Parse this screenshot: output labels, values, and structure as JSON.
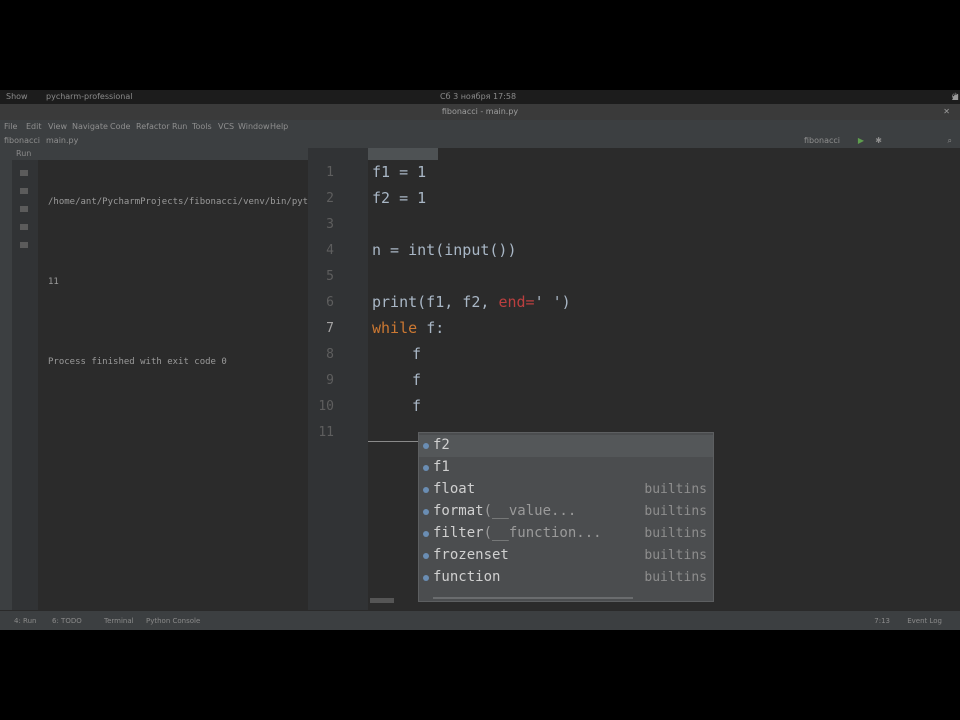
{
  "system": {
    "activities": "Show",
    "app_menu": "pycharm-professional",
    "clock": "Сб 3 ноября 17:58",
    "tray_icons": [
      "network-icon",
      "volume-icon",
      "power-icon"
    ]
  },
  "window": {
    "title": "fibonacci - main.py"
  },
  "menu": {
    "items": [
      "File",
      "Edit",
      "View",
      "Navigate",
      "Code",
      "Refactor",
      "Run",
      "Tools",
      "VCS",
      "Window",
      "Help"
    ]
  },
  "nav": {
    "project": "fibonacci",
    "file": "main.py",
    "run_config": "fibonacci"
  },
  "run_panel": {
    "tab": "Run",
    "lines": [
      "/home/ant/PycharmProjects/fibonacci/venv/bin/python",
      "",
      "11",
      "",
      "Process finished with exit code 0"
    ]
  },
  "editor": {
    "tab": "main.py",
    "line_numbers": [
      "1",
      "2",
      "3",
      "4",
      "5",
      "6",
      "7",
      "8",
      "9",
      "10",
      "11"
    ],
    "active_line": "7",
    "code": {
      "l1": "f1 = 1",
      "l2": "f2 = 1",
      "l4_pre": "n = ",
      "l4_func": "int(input())",
      "l6_pre": "print(f1, f2, ",
      "l6_kw": "end=",
      "l6_post": "' ')",
      "l7_kw": "while ",
      "l7_post": "f:",
      "l8": "f",
      "l9": "f",
      "l10": "f"
    }
  },
  "completion": {
    "items": [
      {
        "name": "f2",
        "hint": "",
        "type": ""
      },
      {
        "name": "f1",
        "hint": "",
        "type": ""
      },
      {
        "name": "float",
        "hint": "",
        "type": "builtins"
      },
      {
        "name": "format",
        "hint": "(__value...",
        "type": "builtins"
      },
      {
        "name": "filter",
        "hint": "(__function...",
        "type": "builtins"
      },
      {
        "name": "frozenset",
        "hint": "",
        "type": "builtins"
      },
      {
        "name": "function",
        "hint": "",
        "type": "builtins"
      }
    ]
  },
  "status": {
    "tabs": [
      "4: Run",
      "6: TODO",
      "Terminal",
      "Python Console"
    ],
    "right": "Event Log",
    "position": "7:13"
  }
}
